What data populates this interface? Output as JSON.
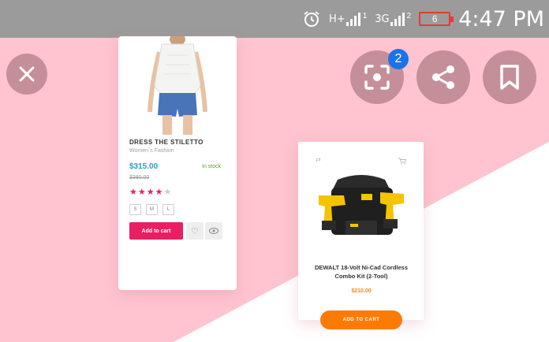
{
  "status_bar": {
    "network_1": "H+",
    "sim_1": "1",
    "network_2": "3G",
    "sim_2": "2",
    "battery_level": "6",
    "time": "4:47 PM"
  },
  "product_left": {
    "name": "DRESS THE STILETTO",
    "category": "Women`s Fashion",
    "price": "$315.00",
    "old_price": "$380.00",
    "stock": "In stock",
    "rating": 4,
    "rating_max": 5,
    "sizes": [
      "S",
      "M",
      "L"
    ],
    "add_to_cart": "Add to cart"
  },
  "product_right": {
    "name": "DEWALT 18-Volt Ni-Cad Cordless Combo Kit (2-Tool)",
    "price": "$210.00",
    "add_to_cart": "ADD TO CART"
  },
  "overlay": {
    "lens_badge_count": "2"
  },
  "colors": {
    "background_pink": "#ffc4cf",
    "status_bar": "#9b9b9b",
    "accent_pink": "#ea1e63",
    "accent_orange": "#ff7a00",
    "price_blue": "#19a7c7",
    "badge_blue": "#1a73e8",
    "battery_red": "#e53935"
  },
  "icons": [
    "alarm-icon",
    "signal-icon",
    "battery-icon",
    "close-icon",
    "lens-icon",
    "share-icon",
    "bookmark-icon",
    "heart-icon",
    "eye-icon",
    "star-icon",
    "cart-icon",
    "compare-icon"
  ]
}
